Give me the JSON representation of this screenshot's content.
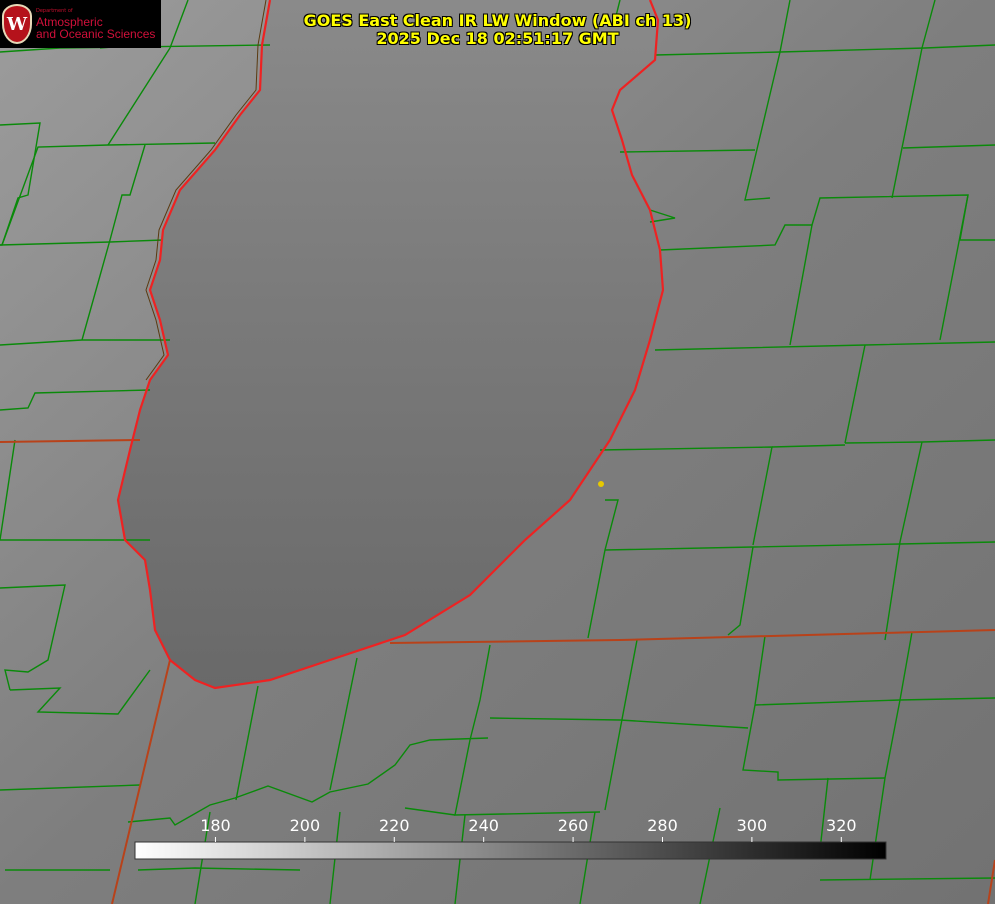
{
  "title": {
    "line1": "GOES East Clean IR LW Window (ABI ch 13)",
    "line2": "2025 Dec 18 02:51:17 GMT"
  },
  "logo": {
    "department": "Department of",
    "line1": "Atmospheric",
    "line2": "and Oceanic Sciences",
    "seal_letter": "W",
    "seal_color": "#b5121b"
  },
  "colorbar": {
    "ticks": [
      180,
      200,
      220,
      240,
      260,
      280,
      300,
      320
    ],
    "range": [
      162,
      330
    ]
  },
  "colors": {
    "county_lines": "#0a8a0a",
    "state_lines": "#d03a1a",
    "lake_outline": "#ee2222",
    "title_text": "#ffff00",
    "station_dot": "#e6c800"
  }
}
